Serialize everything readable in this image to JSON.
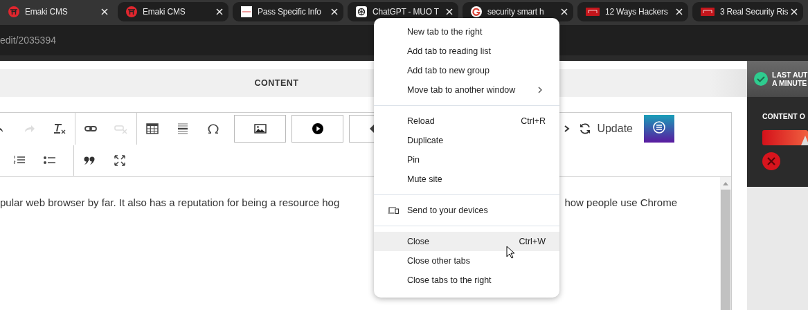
{
  "tabs": [
    {
      "title": "Emaki CMS",
      "selected": true
    },
    {
      "title": "Emaki CMS",
      "selected": false
    },
    {
      "title": "Pass Specific Info",
      "selected": false
    },
    {
      "title": "ChatGPT - MUO T",
      "selected": false
    },
    {
      "title": "security smart h",
      "selected": false
    },
    {
      "title": "12 Ways Hackers",
      "selected": false
    },
    {
      "title": "3 Real Security Ris",
      "selected": false
    }
  ],
  "address_bar": {
    "url": "edit/2035394"
  },
  "content_header": {
    "title": "CONTENT"
  },
  "editor": {
    "toolbar_row_1": [
      {
        "kind": "undo",
        "disabled": false
      },
      {
        "kind": "redo",
        "disabled": true
      },
      {
        "kind": "clear-format",
        "disabled": false
      },
      {
        "kind": "link",
        "disabled": false
      },
      {
        "kind": "unlink",
        "disabled": true
      },
      {
        "kind": "table",
        "disabled": false
      },
      {
        "kind": "hr",
        "disabled": false
      },
      {
        "kind": "omega",
        "disabled": false
      },
      {
        "kind": "image-box",
        "disabled": false
      },
      {
        "kind": "video-box",
        "disabled": false
      },
      {
        "kind": "tag-box",
        "disabled": false
      }
    ],
    "toolbar_row_2": [
      {
        "kind": "numbered-list"
      },
      {
        "kind": "bullet-list"
      },
      {
        "kind": "quote"
      },
      {
        "kind": "fullscreen"
      }
    ],
    "update_button": {
      "label": "Update"
    },
    "text_left": "pular web browser by far. It also has a reputation for being a resource hog",
    "text_right": "how people use Chrome"
  },
  "side_panel": {
    "autosave_line_1": "LAST AUT",
    "autosave_line_2": "A MINUTE",
    "section_title": "CONTENT O"
  },
  "context_menu": {
    "groups": [
      {
        "items": [
          {
            "label": "New tab to the right",
            "kind": "plain",
            "selected": false
          },
          {
            "label": "Add tab to reading list",
            "kind": "plain",
            "selected": false
          },
          {
            "label": "Add tab to new group",
            "kind": "plain",
            "selected": false
          },
          {
            "label": "Move tab to another window",
            "kind": "submenu",
            "selected": false
          }
        ]
      },
      {
        "items": [
          {
            "label": "Reload",
            "kind": "shortcut",
            "shortcut": "Ctrl+R",
            "selected": false
          },
          {
            "label": "Duplicate",
            "kind": "plain",
            "selected": false
          },
          {
            "label": "Pin",
            "kind": "plain",
            "selected": false
          },
          {
            "label": "Mute site",
            "kind": "plain",
            "selected": false
          }
        ]
      },
      {
        "items": [
          {
            "label": "Send to your devices",
            "kind": "device",
            "selected": false
          }
        ]
      },
      {
        "items": [
          {
            "label": "Close",
            "kind": "shortcut",
            "shortcut": "Ctrl+W",
            "selected": true
          },
          {
            "label": "Close other tabs",
            "kind": "plain",
            "selected": false
          },
          {
            "label": "Close tabs to the right",
            "kind": "plain",
            "selected": false
          }
        ]
      }
    ]
  }
}
